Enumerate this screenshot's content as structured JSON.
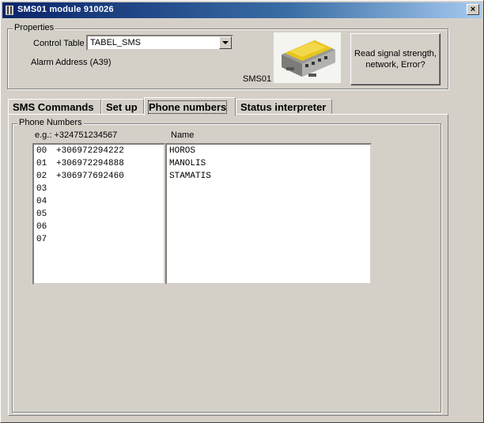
{
  "window": {
    "title": "SMS01 module 910026",
    "close_symbol": "×"
  },
  "properties": {
    "legend": "Properties",
    "control_table_label": "Control Table",
    "control_table_value": "TABEL_SMS",
    "alarm_address_label": "Alarm Address (A39)",
    "device_label": "SMS01",
    "read_button_label": "Read signal strength, network, Error?"
  },
  "tabs": [
    {
      "label": "SMS Commands"
    },
    {
      "label": "Set up"
    },
    {
      "label": "Phone numbers"
    },
    {
      "label": "Status interpreter"
    }
  ],
  "phone_numbers": {
    "legend": "Phone Numbers",
    "example_label": "e.g.: +324751234567",
    "name_header": "Name",
    "rows": [
      {
        "num": "00",
        "phone": "+306972294222",
        "name": "HOROS"
      },
      {
        "num": "01",
        "phone": "+306972294888",
        "name": "MANOLIS"
      },
      {
        "num": "02",
        "phone": "+306977692460",
        "name": "STAMATIS"
      },
      {
        "num": "03",
        "phone": "",
        "name": ""
      },
      {
        "num": "04",
        "phone": "",
        "name": ""
      },
      {
        "num": "05",
        "phone": "",
        "name": ""
      },
      {
        "num": "06",
        "phone": "",
        "name": ""
      },
      {
        "num": "07",
        "phone": "",
        "name": ""
      }
    ]
  },
  "colors": {
    "title_bar": "#0a246a",
    "face": "#d4d0c8"
  }
}
